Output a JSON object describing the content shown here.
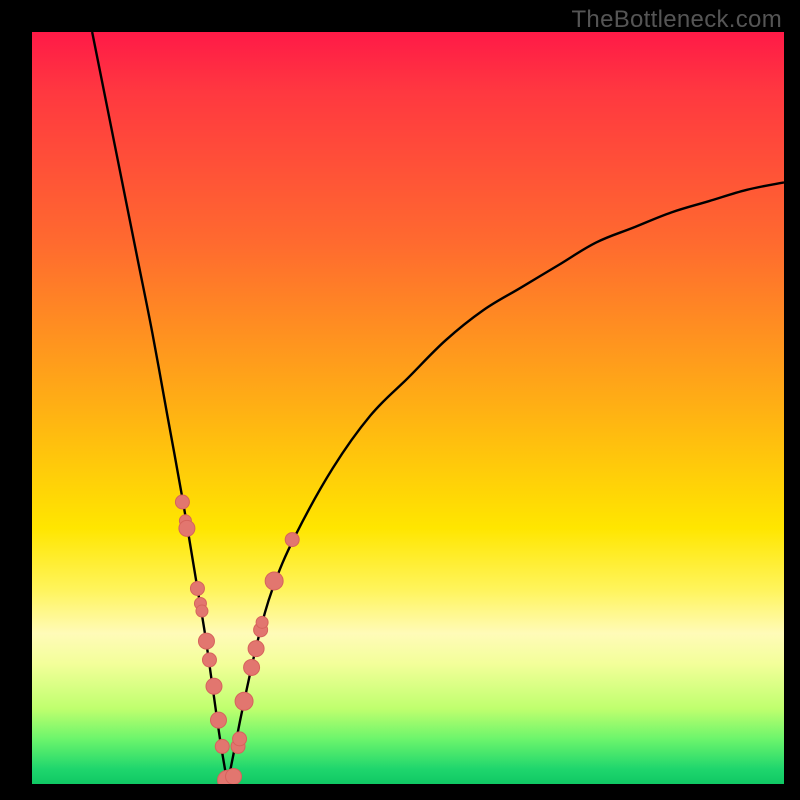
{
  "watermark": "TheBottleneck.com",
  "colors": {
    "bead": "#e2766f",
    "curve": "#000000",
    "frame": "#000000"
  },
  "chart_data": {
    "type": "line",
    "title": "",
    "xlabel": "",
    "ylabel": "",
    "xlim": [
      0,
      100
    ],
    "ylim": [
      0,
      100
    ],
    "grid": false,
    "notes": "V-shaped bottleneck curve on rainbow gradient background. Minimum near x ≈ 26, y ≈ 0. Left branch starts at top edge near x ≈ 8; right branch rises asymptotically, exiting right edge near y ≈ 80.",
    "series": [
      {
        "name": "left-branch",
        "x": [
          8,
          10,
          12,
          14,
          16,
          18,
          20,
          22,
          23,
          24,
          25,
          26
        ],
        "values": [
          100,
          90,
          80,
          70,
          60,
          49,
          38,
          26,
          20,
          13,
          6,
          0
        ]
      },
      {
        "name": "right-branch",
        "x": [
          26,
          27,
          28,
          30,
          32,
          35,
          40,
          45,
          50,
          55,
          60,
          65,
          70,
          75,
          80,
          85,
          90,
          95,
          100
        ],
        "values": [
          0,
          5,
          10,
          19,
          26,
          33,
          42,
          49,
          54,
          59,
          63,
          66,
          69,
          72,
          74,
          76,
          77.5,
          79,
          80
        ]
      }
    ],
    "beads": {
      "name": "data-points",
      "x": [
        20.0,
        20.4,
        20.6,
        22.0,
        22.4,
        22.6,
        23.2,
        23.6,
        24.2,
        24.8,
        25.3,
        26.0,
        26.8,
        27.4,
        27.6,
        28.2,
        29.2,
        29.8,
        30.4,
        30.6,
        32.2,
        34.6
      ],
      "values": [
        37.5,
        35.0,
        34.0,
        26.0,
        24.0,
        23.0,
        19.0,
        16.5,
        13.0,
        8.5,
        5.0,
        0.5,
        1.0,
        5.0,
        6.0,
        11.0,
        15.5,
        18.0,
        20.5,
        21.5,
        27.0,
        32.5
      ],
      "radius": [
        7,
        6,
        8,
        7,
        6,
        6,
        8,
        7,
        8,
        8,
        7,
        10,
        8,
        7,
        7,
        9,
        8,
        8,
        7,
        6,
        9,
        7
      ]
    }
  }
}
